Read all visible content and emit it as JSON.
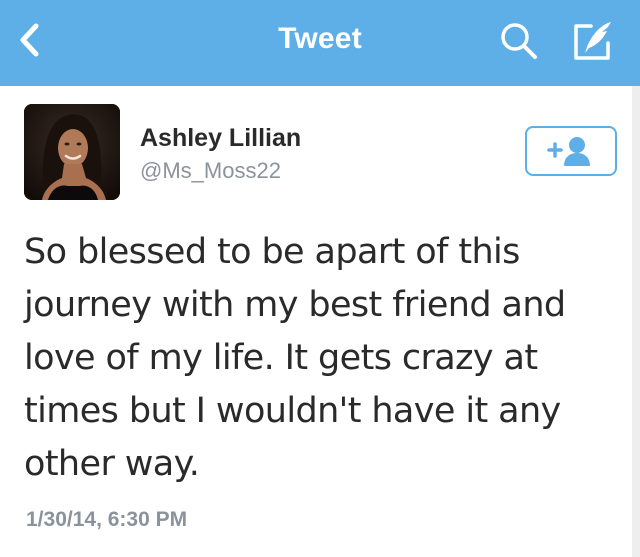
{
  "navbar": {
    "title": "Tweet",
    "back_icon": "chevron-left-icon",
    "search_icon": "search-icon",
    "compose_icon": "compose-icon",
    "background_color": "#5eaee8"
  },
  "tweet": {
    "author": {
      "display_name": "Ashley Lillian",
      "handle": "@Ms_Moss22",
      "avatar": "profile-photo"
    },
    "follow_button": {
      "icon": "add-user-icon",
      "accent_color": "#5eaee8"
    },
    "text": "So blessed to be apart of this journey with my best friend and love of my life. It gets crazy at times but I wouldn't have it any other way.",
    "timestamp": "1/30/14, 6:30 PM"
  }
}
